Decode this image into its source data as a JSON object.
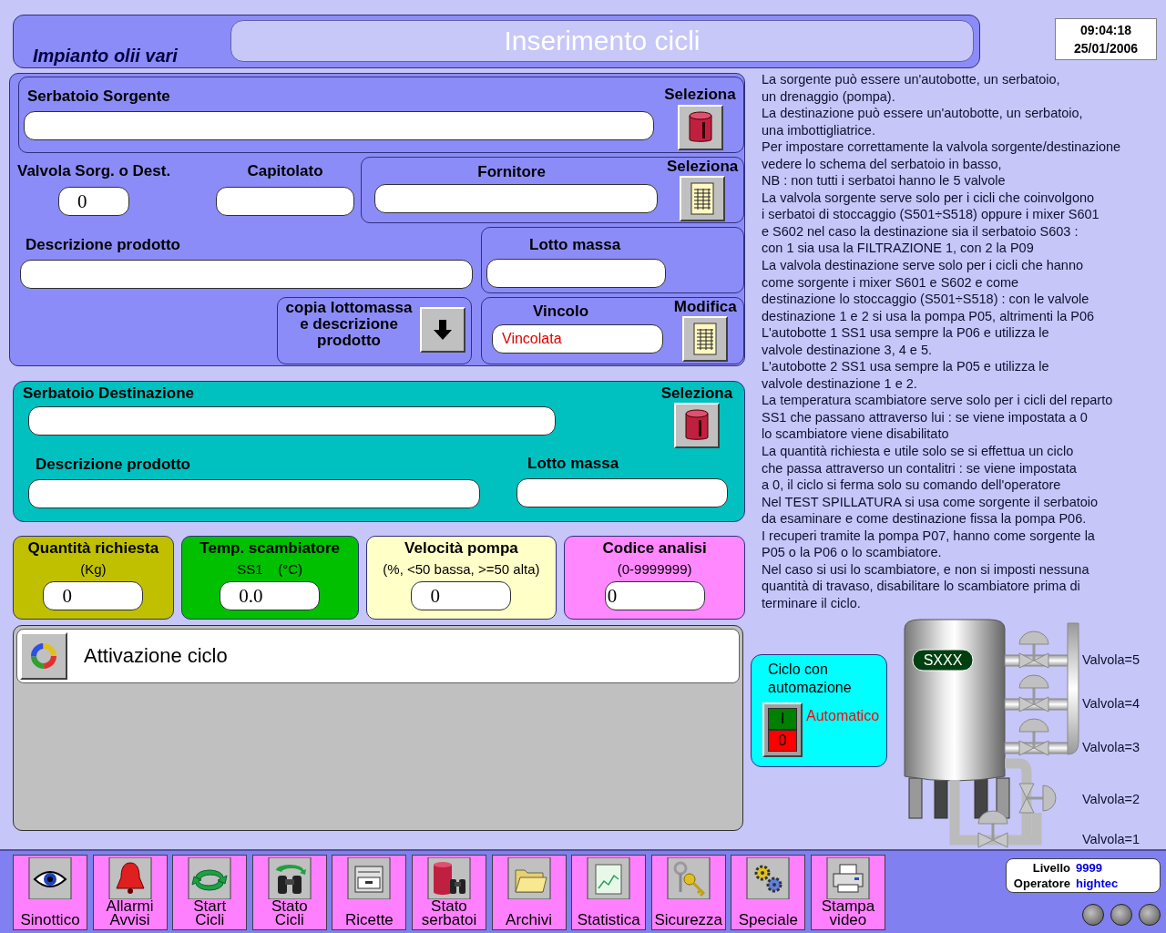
{
  "header": {
    "plant": "Impianto olii vari",
    "title": "Inserimento cicli",
    "time": "09:04:18",
    "date": "25/01/2006"
  },
  "source": {
    "tank_label": "Serbatoio Sorgente",
    "tank_select": "Seleziona",
    "valve_label": "Valvola Sorg. o Dest.",
    "valve_value": "0",
    "spec_label": "Capitolato",
    "supplier_label": "Fornitore",
    "supplier_select": "Seleziona",
    "description_label": "Descrizione prodotto",
    "batch_label": "Lotto massa",
    "copy_label": "copia lottomassa\ne descrizione\nprodotto",
    "constraint_label": "Vincolo",
    "constraint_edit": "Modifica",
    "constraint_value": "Vincolata"
  },
  "destination": {
    "tank_label": "Serbatoio Destinazione",
    "tank_select": "Seleziona",
    "description_label": "Descrizione prodotto",
    "batch_label": "Lotto massa"
  },
  "params": [
    {
      "label": "Quantità richiesta",
      "unit": "(Kg)",
      "value": "0",
      "color": "#c0c000"
    },
    {
      "label": "Temp. scambiatore",
      "unit": "SS1    (°C)",
      "value": "0.0",
      "color": "#00c000"
    },
    {
      "label": "Velocità pompa",
      "unit": "(%, <50 bassa, >=50 alta)",
      "value": "0",
      "color": "#ffffc8"
    },
    {
      "label": "Codice analisi",
      "unit": "(0-9999999)",
      "value": "0",
      "color": "#ff88ff"
    }
  ],
  "activation": {
    "label": "Attivazione ciclo"
  },
  "help_lines": [
    "La sorgente può essere un'autobotte, un serbatoio,",
    "un drenaggio (pompa).",
    "La destinazione può essere un'autobotte, un serbatoio,",
    "una imbottigliatrice.",
    "Per impostare correttamente la valvola sorgente/destinazione",
    "vedere lo schema del serbatoio in basso,",
    "NB : non tutti i serbatoi hanno le 5 valvole",
    "La valvola sorgente serve solo per i cicli che coinvolgono",
    "i serbatoi di stoccaggio (S501÷S518) oppure i mixer S601",
    "e S602 nel caso la destinazione sia il serbatoio S603 :",
    "con 1 sia usa la FILTRAZIONE 1, con 2 la P09",
    "La valvola destinazione serve solo per i cicli che hanno",
    "come sorgente i mixer S601 e S602 e come",
    "destinazione lo stoccaggio (S501÷S518) : con le valvole",
    "destinazione 1 e 2 si usa la pompa P05, altrimenti la P06",
    "L'autobotte 1 SS1 usa sempre la P06 e utilizza le",
    "valvole destinazione 3, 4 e 5.",
    "L'autobotte 2 SS1 usa sempre la P05 e utilizza le",
    "valvole destinazione 1 e 2.",
    "La temperatura scambiatore serve solo per i cicli del reparto",
    "SS1 che passano attraverso lui : se viene impostata a 0",
    "lo scambiatore viene disabilitato",
    "La quantità richiesta e utile solo se si effettua un ciclo",
    "che passa attraverso un contalitri : se viene impostata",
    "a 0, il ciclo si ferma solo su comando dell'operatore",
    "Nel TEST SPILLATURA si usa come sorgente il serbatoio",
    "da esaminare e come destinazione fissa la pompa P06.",
    "I recuperi tramite la pompa P07, hanno come sorgente la",
    "P05 o la P06 o lo scambiatore.",
    "Nel caso si usi lo scambiatore, e non si imposti nessuna",
    "quantità di travaso, disabilitare lo scambiatore prima di",
    "terminare il ciclo."
  ],
  "automation": {
    "title": "Ciclo con automazione",
    "switch_on": "I",
    "switch_off": "0",
    "on": true,
    "mode": "Automatico"
  },
  "tank": {
    "name": "SXXX",
    "valves": [
      "Valvola=5",
      "Valvola=4",
      "Valvola=3",
      "Valvola=2",
      "Valvola=1"
    ]
  },
  "toolbar": [
    {
      "label": "Sinottico",
      "kind": "eye"
    },
    {
      "label": "Allarmi\nAvvisi",
      "kind": "bell"
    },
    {
      "label": "Start\nCicli",
      "kind": "cycle"
    },
    {
      "label": "Stato\nCicli",
      "kind": "binoculars"
    },
    {
      "label": "Ricette",
      "kind": "drawer"
    },
    {
      "label": "Stato\nserbatoi",
      "kind": "tank"
    },
    {
      "label": "Archivi",
      "kind": "folder"
    },
    {
      "label": "Statistica",
      "kind": "chart"
    },
    {
      "label": "Sicurezza",
      "kind": "keys"
    },
    {
      "label": "Speciale",
      "kind": "gears"
    },
    {
      "label": "Stampa\nvideo",
      "kind": "printer"
    }
  ],
  "user": {
    "level_label": "Livello",
    "level": "9999",
    "operator_label": "Operatore",
    "operator": "hightec"
  }
}
